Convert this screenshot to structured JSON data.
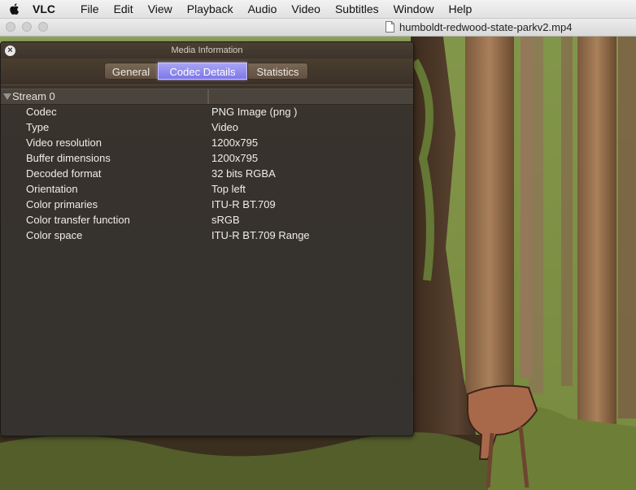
{
  "menubar": {
    "app_name": "VLC",
    "items": [
      "File",
      "Edit",
      "View",
      "Playback",
      "Audio",
      "Video",
      "Subtitles",
      "Window",
      "Help"
    ]
  },
  "player_window": {
    "filename": "humboldt-redwood-state-parkv2.mp4"
  },
  "media_info": {
    "title": "Media Information",
    "close_glyph": "×",
    "tabs": [
      "General",
      "Codec Details",
      "Statistics"
    ],
    "active_tab": "Codec Details",
    "stream_label": "Stream 0",
    "rows": [
      {
        "key": "Codec",
        "value": "PNG Image (png )"
      },
      {
        "key": "Type",
        "value": "Video"
      },
      {
        "key": "Video resolution",
        "value": "1200x795"
      },
      {
        "key": "Buffer dimensions",
        "value": "1200x795"
      },
      {
        "key": "Decoded format",
        "value": "32 bits RGBA"
      },
      {
        "key": "Orientation",
        "value": "Top left"
      },
      {
        "key": "Color primaries",
        "value": "ITU-R BT.709"
      },
      {
        "key": "Color transfer function",
        "value": "sRGB"
      },
      {
        "key": "Color space",
        "value": "ITU-R BT.709 Range"
      }
    ]
  },
  "colors": {
    "active_tab": "#8f8af0",
    "panel_bg": "#37322d"
  }
}
